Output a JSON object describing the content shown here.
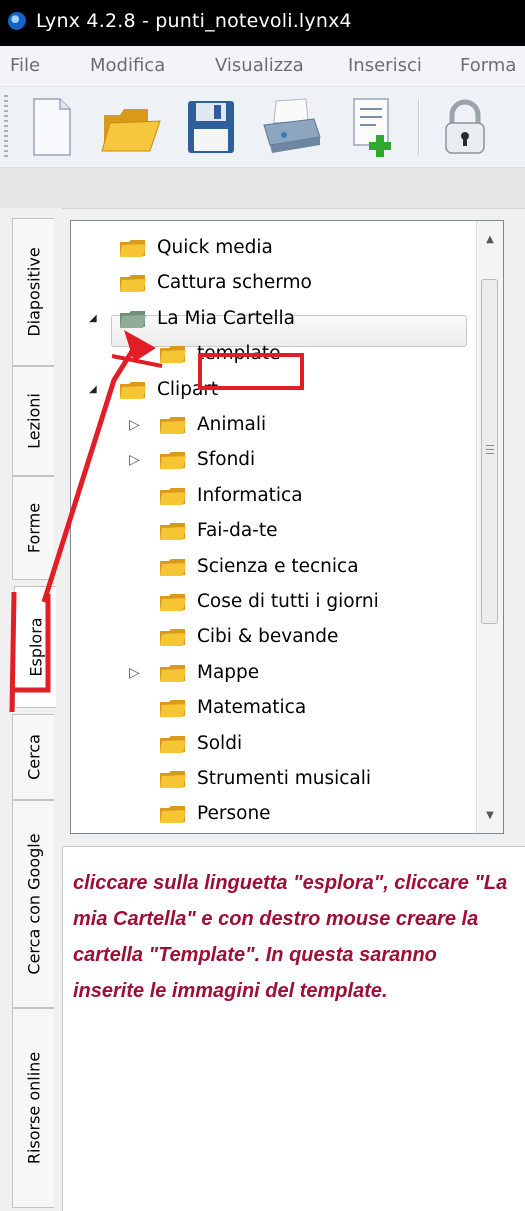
{
  "window": {
    "title": "Lynx 4.2.8 - punti_notevoli.lynx4"
  },
  "menu": [
    "File",
    "Modifica",
    "Visualizza",
    "Inserisci",
    "Forma"
  ],
  "toolbar": {
    "buttons": [
      {
        "name": "new-document",
        "icon": "blank-page-icon"
      },
      {
        "name": "open",
        "icon": "open-folder-icon"
      },
      {
        "name": "save",
        "icon": "floppy-disk-icon"
      },
      {
        "name": "print",
        "icon": "printer-icon"
      },
      {
        "name": "add-page",
        "icon": "page-plus-icon"
      },
      {
        "name": "lock",
        "icon": "padlock-icon"
      }
    ]
  },
  "tabs": [
    "Diapositive",
    "Lezioni",
    "Forme",
    "Esplora",
    "Cerca",
    "Cerca con Google",
    "Risorse online"
  ],
  "active_tab": "Esplora",
  "tree": [
    {
      "label": "Quick media",
      "level": 1,
      "expander": "none"
    },
    {
      "label": "Cattura schermo",
      "level": 1,
      "expander": "none"
    },
    {
      "label": "La Mia Cartella",
      "level": 1,
      "expander": "expanded",
      "selected": true
    },
    {
      "label": "template",
      "level": 2,
      "expander": "none",
      "highlighted": true
    },
    {
      "label": "Clipart",
      "level": 1,
      "expander": "expanded"
    },
    {
      "label": "Animali",
      "level": 2,
      "expander": "collapsed"
    },
    {
      "label": "Sfondi",
      "level": 2,
      "expander": "collapsed"
    },
    {
      "label": "Informatica",
      "level": 2,
      "expander": "none"
    },
    {
      "label": "Fai-da-te",
      "level": 2,
      "expander": "none"
    },
    {
      "label": "Scienza e tecnica",
      "level": 2,
      "expander": "none"
    },
    {
      "label": "Cose di tutti i giorni",
      "level": 2,
      "expander": "none"
    },
    {
      "label": "Cibi & bevande",
      "level": 2,
      "expander": "none"
    },
    {
      "label": "Mappe",
      "level": 2,
      "expander": "collapsed"
    },
    {
      "label": "Matematica",
      "level": 2,
      "expander": "none"
    },
    {
      "label": "Soldi",
      "level": 2,
      "expander": "none"
    },
    {
      "label": "Strumenti musicali",
      "level": 2,
      "expander": "none"
    },
    {
      "label": "Persone",
      "level": 2,
      "expander": "none",
      "partially_visible": true
    }
  ],
  "description": "cliccare sulla linguetta \"esplora\", cliccare \"La mia Cartella\" e con destro mouse creare la cartella \"Template\". In questa saranno inserite le immagini del template.",
  "colors": {
    "annotation_red": "#e11d26",
    "description_text": "#9e0f35",
    "title_bar": "#000000",
    "folder_yellow": "#f5c533",
    "folder_green": "#8fae98"
  }
}
